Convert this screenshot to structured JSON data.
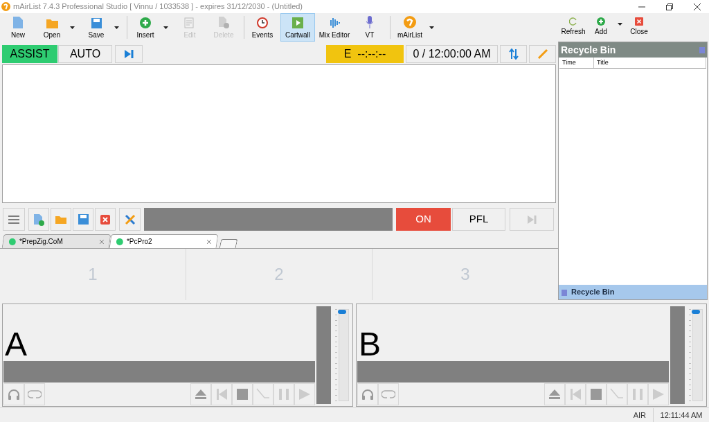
{
  "window": {
    "title": "mAirList 7.4.3 Professional Studio [ Vinnu / 1033538 ] - expires 31/12/2030 - (Untitled)"
  },
  "toolbar": {
    "groups": [
      [
        {
          "label": "New",
          "disabled": false,
          "selected": false,
          "dropdown": false
        },
        {
          "label": "Open",
          "disabled": false,
          "selected": false,
          "dropdown": true
        },
        {
          "label": "Save",
          "disabled": false,
          "selected": false,
          "dropdown": true
        }
      ],
      [
        {
          "label": "Insert",
          "disabled": false,
          "selected": false,
          "dropdown": true
        },
        {
          "label": "Edit",
          "disabled": true,
          "selected": false,
          "dropdown": false
        },
        {
          "label": "Delete",
          "disabled": true,
          "selected": false,
          "dropdown": false
        }
      ],
      [
        {
          "label": "Events",
          "disabled": false,
          "selected": false,
          "dropdown": false
        },
        {
          "label": "Cartwall",
          "disabled": false,
          "selected": true,
          "dropdown": false
        },
        {
          "label": "Mix Editor",
          "disabled": false,
          "selected": false,
          "dropdown": false
        },
        {
          "label": "VT",
          "disabled": false,
          "selected": false,
          "dropdown": false
        }
      ],
      [
        {
          "label": "mAirList",
          "disabled": false,
          "selected": false,
          "dropdown": true
        }
      ]
    ],
    "panel_items": [
      {
        "label": "Refresh",
        "dropdown": false
      },
      {
        "label": "Add",
        "dropdown": true
      },
      {
        "label": "Close",
        "dropdown": false
      }
    ]
  },
  "mode_bar": {
    "modes": [
      {
        "label": "ASSIST",
        "selected": true
      },
      {
        "label": "AUTO",
        "selected": false
      }
    ],
    "end_time": "E  --:--:--",
    "clock": "0 / 12:00:00 AM"
  },
  "player_bar": {
    "on_button": {
      "label": "ON",
      "on": true
    },
    "pfl_button": {
      "label": "PFL"
    },
    "skip_disabled": true
  },
  "cart_tabs": [
    {
      "label": "*PrepZig.CoM",
      "selected": false
    },
    {
      "label": "*PcPro2",
      "selected": true
    }
  ],
  "cart_slots": [
    "1",
    "2",
    "3"
  ],
  "players": [
    {
      "label": "A",
      "level": 1
    },
    {
      "label": "B",
      "level": 1
    }
  ],
  "recycle_bin": {
    "title": "Recycle Bin",
    "columns": [
      "Time",
      "Title"
    ],
    "footer_tab": "Recycle Bin"
  },
  "status_bar": [
    "AIR",
    "12:11:44 AM"
  ]
}
